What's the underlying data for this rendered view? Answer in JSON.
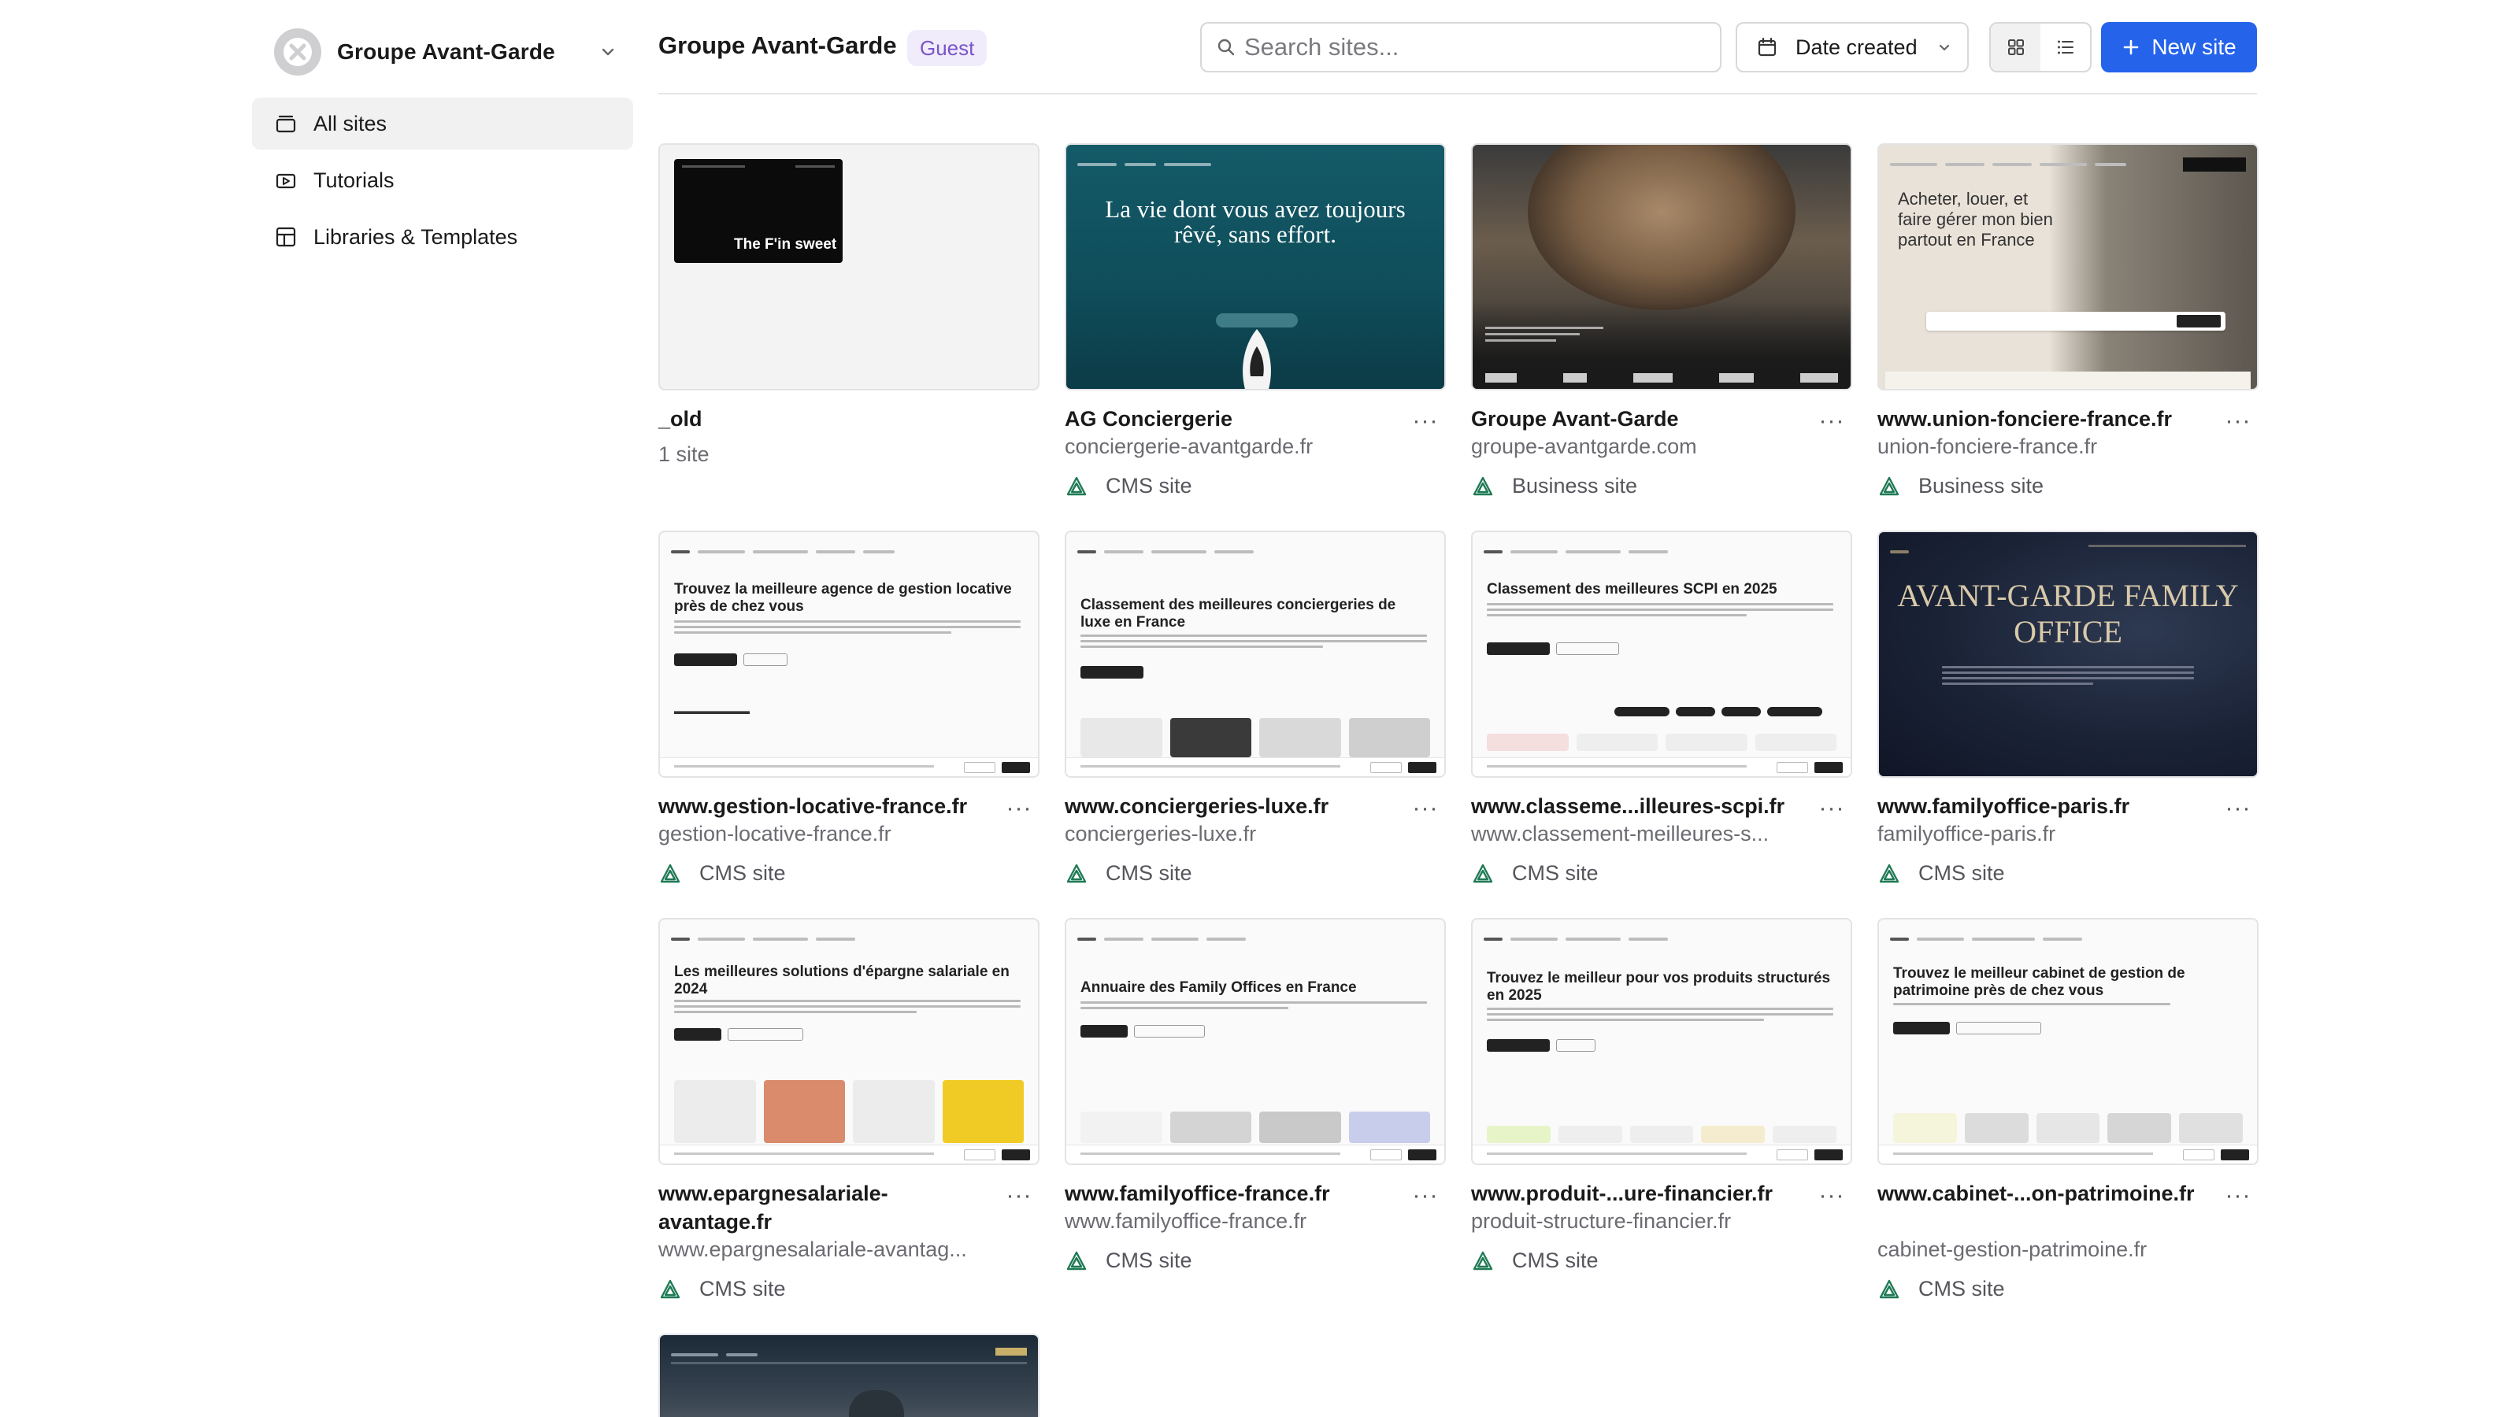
{
  "workspace": {
    "name": "Groupe Avant-Garde"
  },
  "sidebar": {
    "items": [
      {
        "label": "All sites",
        "icon": "stack-icon",
        "active": true
      },
      {
        "label": "Tutorials",
        "icon": "video-icon",
        "active": false
      },
      {
        "label": "Libraries & Templates",
        "icon": "layout-icon",
        "active": false
      }
    ]
  },
  "header": {
    "title": "Groupe Avant-Garde",
    "badge": "Guest",
    "search_placeholder": "Search sites...",
    "sort_label": "Date created",
    "new_site_label": "New site"
  },
  "colors": {
    "accent": "#2563eb",
    "badge_bg": "#f1ecfb",
    "badge_text": "#7a55c9",
    "brand_green": "#1f7a55"
  },
  "sites": [
    {
      "title": "_old",
      "domain": "1 site",
      "type": "",
      "thumb_text": "The F'in sweet"
    },
    {
      "title": "AG Conciergerie",
      "domain": "conciergerie-avantgarde.fr",
      "type": "CMS site",
      "thumb_text": "La vie dont vous avez toujours rêvé, sans effort."
    },
    {
      "title": "Groupe Avant-Garde",
      "domain": "groupe-avantgarde.com",
      "type": "Business site"
    },
    {
      "title": "www.union-fonciere-france.fr",
      "domain": "union-fonciere-france.fr",
      "type": "Business site",
      "thumb_text": "Acheter, louer, et faire gérer mon bien partout en France"
    },
    {
      "title": "www.gestion-locative-france.fr",
      "domain": "gestion-locative-france.fr",
      "type": "CMS site",
      "thumb_text": "Trouvez la meilleure agence de gestion locative près de chez vous"
    },
    {
      "title": "www.conciergeries-luxe.fr",
      "domain": "conciergeries-luxe.fr",
      "type": "CMS site",
      "thumb_text": "Classement des meilleures conciergeries de luxe en France"
    },
    {
      "title": "www.classeme...illeures-scpi.fr",
      "domain": "www.classement-meilleures-s...",
      "type": "CMS site",
      "thumb_text": "Classement des meilleures SCPI en 2025"
    },
    {
      "title": "www.familyoffice-paris.fr",
      "domain": "familyoffice-paris.fr",
      "type": "CMS site",
      "thumb_text": "AVANT-GARDE FAMILY OFFICE"
    },
    {
      "title": "www.epargnesalariale-avantage.fr",
      "domain": "www.epargnesalariale-avantag...",
      "type": "CMS site",
      "thumb_text": "Les meilleures solutions d'épargne salariale en 2024"
    },
    {
      "title": "www.familyoffice-france.fr",
      "domain": "www.familyoffice-france.fr",
      "type": "CMS site",
      "thumb_text": "Annuaire des Family Offices en France"
    },
    {
      "title": "www.produit-...ure-financier.fr",
      "domain": "produit-structure-financier.fr",
      "type": "CMS site",
      "thumb_text": "Trouvez le meilleur pour vos produits structurés en 2025"
    },
    {
      "title": "www.cabinet-...on-patrimoine.fr",
      "domain": "cabinet-gestion-patrimoine.fr",
      "type": "CMS site",
      "thumb_text": "Trouvez le meilleur cabinet de gestion de patrimoine près de chez vous"
    }
  ]
}
